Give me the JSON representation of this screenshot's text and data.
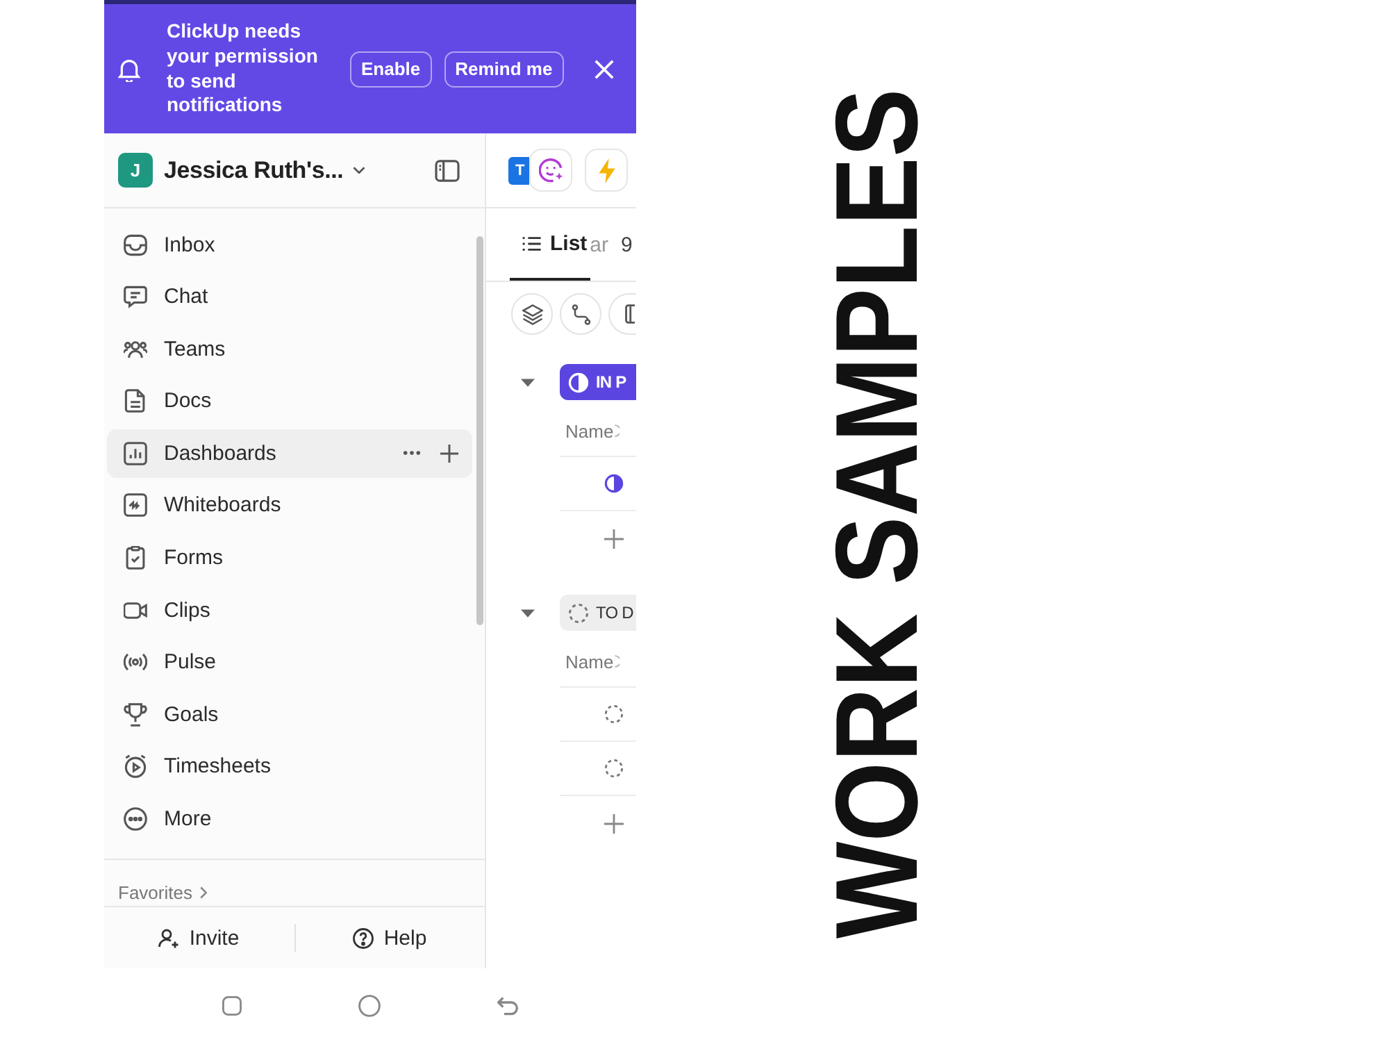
{
  "notification_banner": {
    "message": "ClickUp needs your permission to send notifications",
    "buttons": [
      "Enable",
      "Remind me"
    ]
  },
  "workspace": {
    "initial": "J",
    "name": "Jessica Ruth's..."
  },
  "sidebar": {
    "items": [
      {
        "label": "Inbox",
        "selected": false
      },
      {
        "label": "Chat",
        "selected": false
      },
      {
        "label": "Teams",
        "selected": false
      },
      {
        "label": "Docs",
        "selected": false
      },
      {
        "label": "Dashboards",
        "selected": true
      },
      {
        "label": "Whiteboards",
        "selected": false
      },
      {
        "label": "Forms",
        "selected": false
      },
      {
        "label": "Clips",
        "selected": false
      },
      {
        "label": "Pulse",
        "selected": false
      },
      {
        "label": "Goals",
        "selected": false
      },
      {
        "label": "Timesheets",
        "selected": false
      },
      {
        "label": "More",
        "selected": false
      }
    ],
    "favorites": "Favorites",
    "footer": [
      "Invite",
      "Help"
    ]
  },
  "main_panel": {
    "avatar": "T",
    "view_tabs": [
      {
        "label": "List",
        "selected": true
      },
      {
        "label": "ar",
        "selected": false
      }
    ],
    "count": "9",
    "groups": [
      {
        "kind": "in_progress",
        "label": "IN P",
        "expanded": true,
        "column": "Name",
        "tasks": [
          {
            "kind": "in_progress"
          }
        ]
      },
      {
        "kind": "todo",
        "label": "TO D",
        "expanded": true,
        "column": "Name",
        "tasks": [
          {
            "kind": "todo"
          },
          {
            "kind": "todo"
          }
        ]
      }
    ]
  },
  "side_title": "WORK SAMPLES"
}
